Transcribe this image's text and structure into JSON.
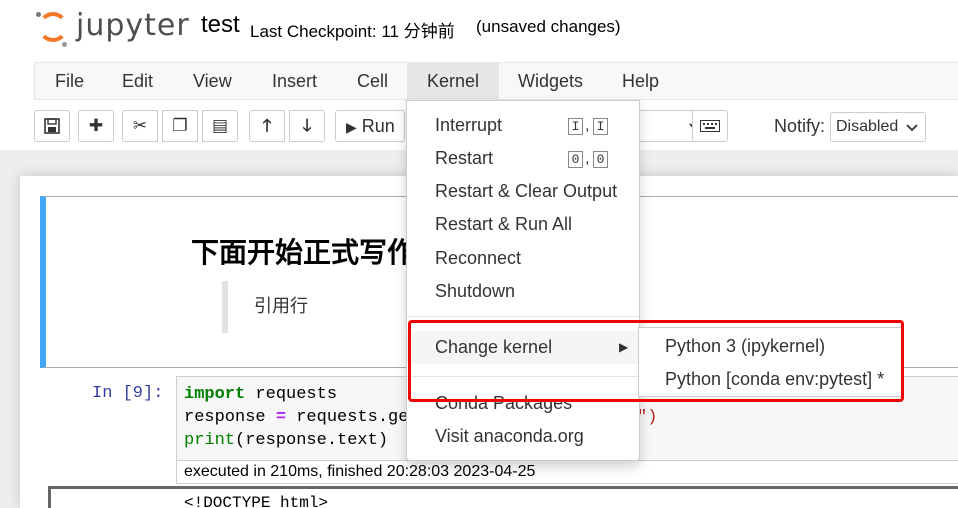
{
  "header": {
    "logo_text": "jupyter",
    "notebook_name": "test",
    "checkpoint": "Last Checkpoint: 11 分钟前",
    "autosave_status": "(unsaved changes)"
  },
  "menubar": {
    "items": [
      {
        "label": "File"
      },
      {
        "label": "Edit"
      },
      {
        "label": "View"
      },
      {
        "label": "Insert"
      },
      {
        "label": "Cell"
      },
      {
        "label": "Kernel"
      },
      {
        "label": "Widgets"
      },
      {
        "label": "Help"
      }
    ]
  },
  "toolbar": {
    "run_label": "Run",
    "notify_label": "Notify:",
    "notify_value": "Disabled"
  },
  "kernel_menu": {
    "items": [
      {
        "label": "Interrupt",
        "keys": [
          "I",
          "I"
        ]
      },
      {
        "label": "Restart",
        "keys": [
          "0",
          "0"
        ]
      },
      {
        "label": "Restart & Clear Output"
      },
      {
        "label": "Restart & Run All"
      },
      {
        "label": "Reconnect"
      },
      {
        "label": "Shutdown"
      },
      {
        "label": "Change kernel"
      },
      {
        "label": "Conda Packages"
      },
      {
        "label": "Visit anaconda.org"
      }
    ],
    "submenu": [
      {
        "label": "Python 3 (ipykernel)"
      },
      {
        "label": "Python [conda env:pytest] *"
      }
    ]
  },
  "notebook": {
    "markdown_heading": "下面开始正式写作",
    "markdown_quote": "引用行",
    "code_prompt": "In [9]:",
    "code_line1_kw": "import",
    "code_line1_rest": " requests",
    "code_line2_a": "response ",
    "code_line2_op": "=",
    "code_line2_b": " requests.get(",
    "code_line2_str": "\")",
    "code_line3_kw": "print",
    "code_line3_rest": "(response.text)",
    "exec_info": "executed in 210ms, finished 20:28:03 2023-04-25",
    "output_text": "<!DOCTYPE html>"
  }
}
